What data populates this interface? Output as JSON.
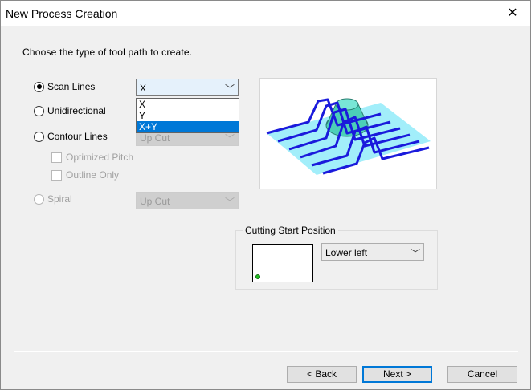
{
  "window": {
    "title": "New Process Creation",
    "close_glyph": "✕"
  },
  "prompt": "Choose the type of tool path to create.",
  "options": {
    "scan_lines": {
      "label": "Scan Lines",
      "selected": true,
      "combo_value": "X"
    },
    "unidirectional": {
      "label": "Unidirectional",
      "selected": false
    },
    "contour_lines": {
      "label": "Contour Lines",
      "selected": false,
      "combo_value": "Up Cut"
    },
    "optimized_pitch": {
      "label": "Optimized Pitch",
      "checked": false
    },
    "outline_only": {
      "label": "Outline Only",
      "checked": false
    },
    "spiral": {
      "label": "Spiral",
      "selected": false,
      "combo_value": "Up Cut"
    }
  },
  "scan_dropdown": {
    "items": [
      "X",
      "Y",
      "X+Y"
    ],
    "highlighted": "X+Y"
  },
  "cutting_start": {
    "title": "Cutting Start Position",
    "value": "Lower left"
  },
  "buttons": {
    "back": "< Back",
    "next": "Next >",
    "cancel": "Cancel"
  },
  "colors": {
    "accent": "#0078d7",
    "toolpath": "#1a1adc",
    "toolpath_fill": "#55e0f5",
    "shape_fill": "#4ccfb8"
  },
  "icons": {
    "close": "close-icon",
    "arrow": "chevron-down-icon"
  }
}
